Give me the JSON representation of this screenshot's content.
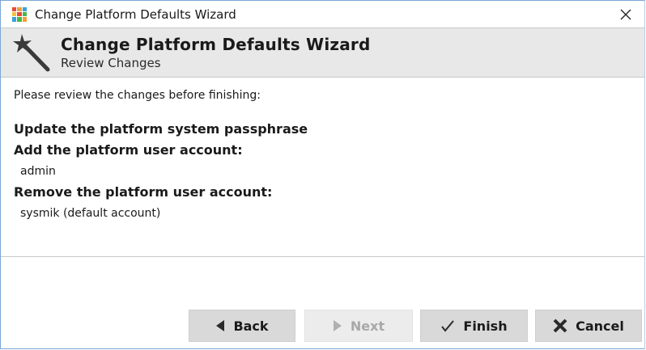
{
  "window": {
    "title": "Change Platform Defaults Wizard",
    "app_icon": "niagara-app-icon",
    "close_icon": "close-icon"
  },
  "banner": {
    "icon": "magic-wand-icon",
    "title": "Change Platform Defaults Wizard",
    "subtitle": "Review Changes"
  },
  "content": {
    "intro": "Please review the changes before finishing:",
    "changes": [
      {
        "heading": "Update the platform system passphrase"
      },
      {
        "heading": "Add the platform user account:",
        "item": "admin"
      },
      {
        "heading": "Remove the platform user account:",
        "item": "sysmik (default account)"
      }
    ]
  },
  "buttons": {
    "back": {
      "label": "Back",
      "icon": "arrow-left-icon",
      "enabled": true
    },
    "next": {
      "label": "Next",
      "icon": "arrow-right-icon",
      "enabled": false
    },
    "finish": {
      "label": "Finish",
      "icon": "checkmark-icon",
      "enabled": true
    },
    "cancel": {
      "label": "Cancel",
      "icon": "x-icon",
      "enabled": true
    }
  },
  "colors": {
    "banner_bg": "#e8e8e8",
    "button_bg": "#d9d9d9",
    "button_disabled_bg": "#ececec",
    "window_border": "#7aa6d6"
  }
}
